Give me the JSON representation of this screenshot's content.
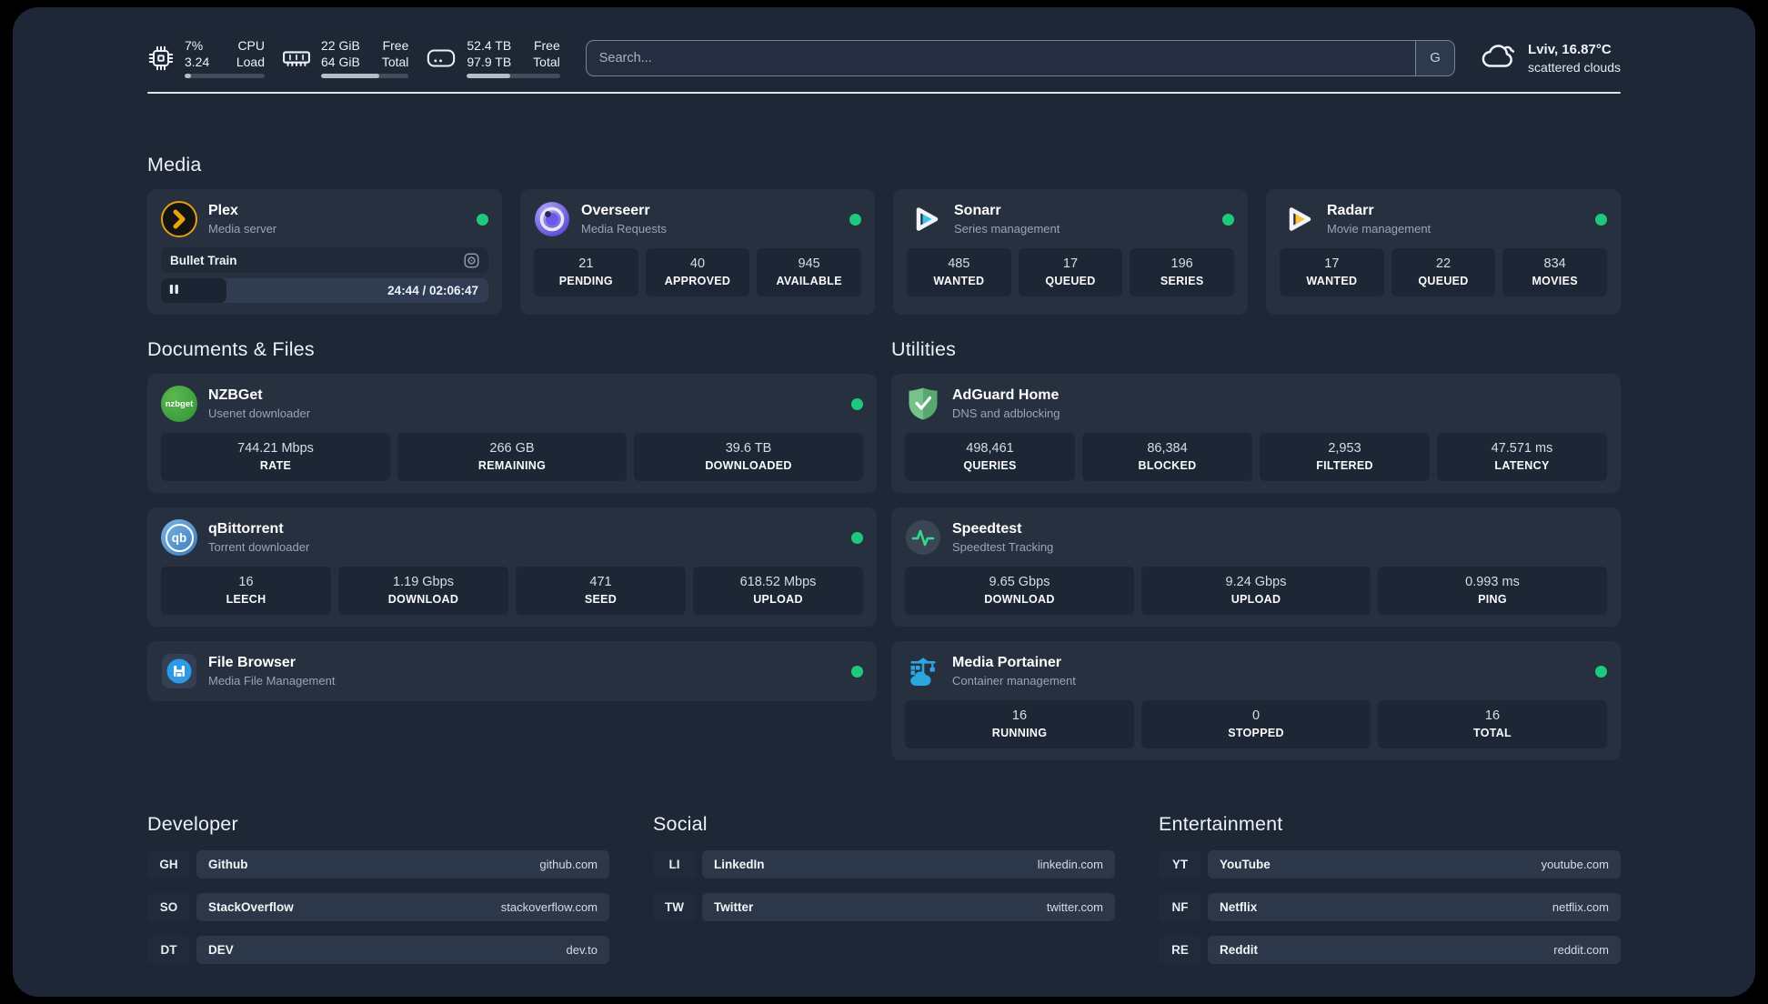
{
  "header": {
    "stats": [
      {
        "icon": "cpu-icon",
        "values": [
          "7%",
          "3.24"
        ],
        "labels": [
          "CPU",
          "Load"
        ],
        "progress": "8%"
      },
      {
        "icon": "memory-icon",
        "values": [
          "22 GiB",
          "64 GiB"
        ],
        "labels": [
          "Free",
          "Total"
        ],
        "progress": "66%"
      },
      {
        "icon": "storage-icon",
        "values": [
          "52.4 TB",
          "97.9 TB"
        ],
        "labels": [
          "Free",
          "Total"
        ],
        "progress": "47%"
      }
    ],
    "search": {
      "placeholder": "Search...",
      "engine_button": "G"
    },
    "weather": {
      "location": "Lviv, 16.87°C",
      "condition": "scattered clouds"
    }
  },
  "media": {
    "title": "Media",
    "plex": {
      "name": "Plex",
      "description": "Media server",
      "status": "online",
      "now_playing": "Bullet Train",
      "time": "24:44 / 02:06:47",
      "progress": "20%"
    },
    "overseerr": {
      "name": "Overseerr",
      "description": "Media Requests",
      "status": "online",
      "stats": [
        {
          "value": "21",
          "label": "PENDING"
        },
        {
          "value": "40",
          "label": "APPROVED"
        },
        {
          "value": "945",
          "label": "AVAILABLE"
        }
      ]
    },
    "sonarr": {
      "name": "Sonarr",
      "description": "Series management",
      "status": "online",
      "stats": [
        {
          "value": "485",
          "label": "WANTED"
        },
        {
          "value": "17",
          "label": "QUEUED"
        },
        {
          "value": "196",
          "label": "SERIES"
        }
      ]
    },
    "radarr": {
      "name": "Radarr",
      "description": "Movie management",
      "status": "online",
      "stats": [
        {
          "value": "17",
          "label": "WANTED"
        },
        {
          "value": "22",
          "label": "QUEUED"
        },
        {
          "value": "834",
          "label": "MOVIES"
        }
      ]
    }
  },
  "documents": {
    "title": "Documents & Files",
    "nzbget": {
      "name": "NZBGet",
      "description": "Usenet downloader",
      "icon_text": "nzbget",
      "status": "online",
      "stats": [
        {
          "value": "744.21 Mbps",
          "label": "RATE"
        },
        {
          "value": "266 GB",
          "label": "REMAINING"
        },
        {
          "value": "39.6 TB",
          "label": "DOWNLOADED"
        }
      ]
    },
    "qbittorrent": {
      "name": "qBittorrent",
      "description": "Torrent downloader",
      "icon_text": "qb",
      "status": "online",
      "stats": [
        {
          "value": "16",
          "label": "LEECH"
        },
        {
          "value": "1.19 Gbps",
          "label": "DOWNLOAD"
        },
        {
          "value": "471",
          "label": "SEED"
        },
        {
          "value": "618.52 Mbps",
          "label": "UPLOAD"
        }
      ]
    },
    "filebrowser": {
      "name": "File Browser",
      "description": "Media File Management",
      "status": "online"
    }
  },
  "utilities": {
    "title": "Utilities",
    "adguard": {
      "name": "AdGuard Home",
      "description": "DNS and adblocking",
      "stats": [
        {
          "value": "498,461",
          "label": "QUERIES"
        },
        {
          "value": "86,384",
          "label": "BLOCKED"
        },
        {
          "value": "2,953",
          "label": "FILTERED"
        },
        {
          "value": "47.571 ms",
          "label": "LATENCY"
        }
      ]
    },
    "speedtest": {
      "name": "Speedtest",
      "description": "Speedtest Tracking",
      "stats": [
        {
          "value": "9.65 Gbps",
          "label": "DOWNLOAD"
        },
        {
          "value": "9.24 Gbps",
          "label": "UPLOAD"
        },
        {
          "value": "0.993 ms",
          "label": "PING"
        }
      ]
    },
    "portainer": {
      "name": "Media Portainer",
      "description": "Container management",
      "status": "online",
      "stats": [
        {
          "value": "16",
          "label": "RUNNING"
        },
        {
          "value": "0",
          "label": "STOPPED"
        },
        {
          "value": "16",
          "label": "TOTAL"
        }
      ]
    }
  },
  "links": {
    "developer": {
      "title": "Developer",
      "items": [
        {
          "abbr": "GH",
          "name": "Github",
          "url": "github.com"
        },
        {
          "abbr": "SO",
          "name": "StackOverflow",
          "url": "stackoverflow.com"
        },
        {
          "abbr": "DT",
          "name": "DEV",
          "url": "dev.to"
        }
      ]
    },
    "social": {
      "title": "Social",
      "items": [
        {
          "abbr": "LI",
          "name": "LinkedIn",
          "url": "linkedin.com"
        },
        {
          "abbr": "TW",
          "name": "Twitter",
          "url": "twitter.com"
        }
      ]
    },
    "entertainment": {
      "title": "Entertainment",
      "items": [
        {
          "abbr": "YT",
          "name": "YouTube",
          "url": "youtube.com"
        },
        {
          "abbr": "NF",
          "name": "Netflix",
          "url": "netflix.com"
        },
        {
          "abbr": "RE",
          "name": "Reddit",
          "url": "reddit.com"
        }
      ]
    }
  },
  "colors": {
    "status_online": "#1dc97d",
    "plex": "#e5a00d",
    "sonarr": "#35c5f1",
    "radarr": "#ffc230",
    "adguard": "#68b47b",
    "speedtest": "#35d98a",
    "portainer": "#2ba6e0",
    "filebrowser": "#2d9ae8"
  }
}
